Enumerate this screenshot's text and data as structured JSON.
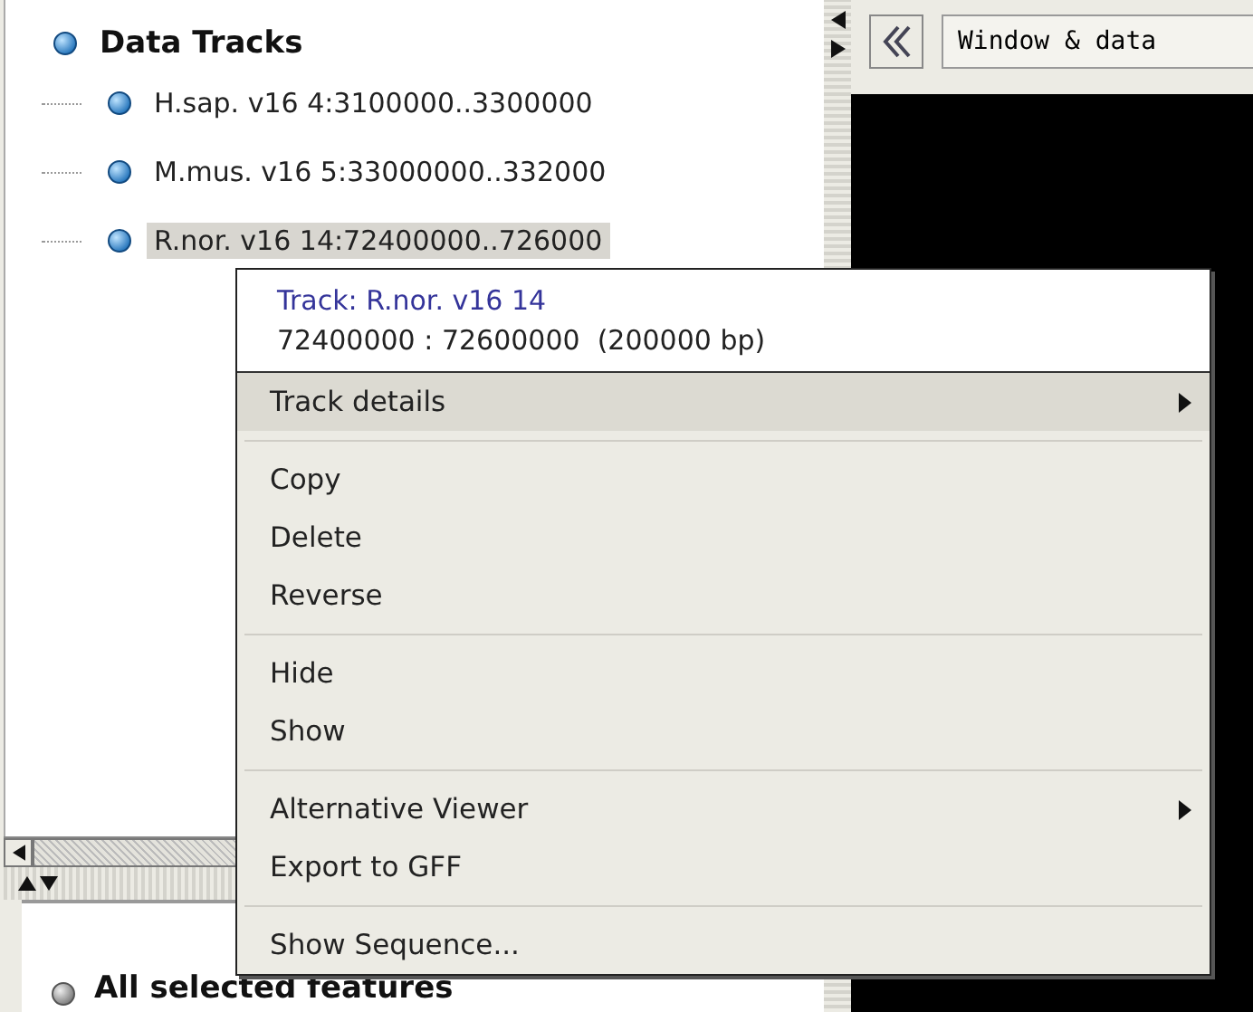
{
  "tree": {
    "label": "Data Tracks",
    "children": [
      {
        "label": "H.sap. v16 4:3100000..3300000",
        "selected": false
      },
      {
        "label": "M.mus. v16 5:33000000..332000",
        "selected": false
      },
      {
        "label": "R.nor. v16 14:72400000..726000",
        "selected": true
      }
    ]
  },
  "toolbar": {
    "view_field": "Window & data"
  },
  "bottom_panel": {
    "title": "All selected features"
  },
  "context_menu": {
    "title": "Track: R.nor. v16 14",
    "range": "72400000 : 72600000  (200000 bp)",
    "groups": [
      [
        {
          "label": "Track details",
          "selected": true,
          "submenu": true
        }
      ],
      [
        {
          "label": "Copy",
          "selected": false,
          "submenu": false
        },
        {
          "label": "Delete",
          "selected": false,
          "submenu": false
        },
        {
          "label": "Reverse",
          "selected": false,
          "submenu": false
        }
      ],
      [
        {
          "label": "Hide",
          "selected": false,
          "submenu": false
        },
        {
          "label": "Show",
          "selected": false,
          "submenu": false
        }
      ],
      [
        {
          "label": "Alternative Viewer",
          "selected": false,
          "submenu": true
        },
        {
          "label": "Export to GFF",
          "selected": false,
          "submenu": false
        }
      ],
      [
        {
          "label": "Show Sequence...",
          "selected": false,
          "submenu": false
        }
      ]
    ]
  }
}
